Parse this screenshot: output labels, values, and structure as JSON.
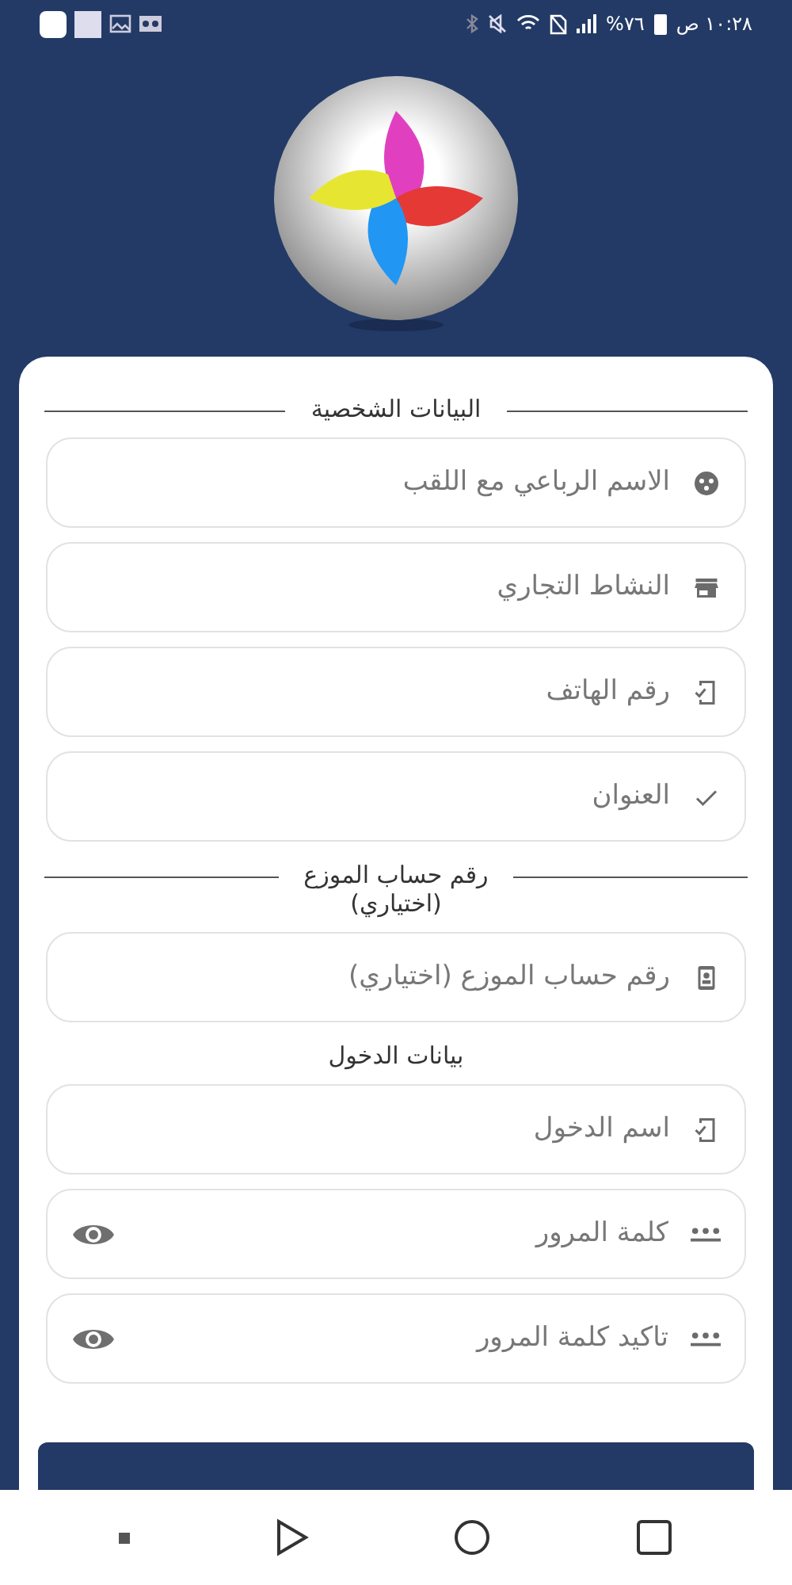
{
  "status_bar": {
    "time": "١٠:٢٨ ص",
    "battery": "%٧٦"
  },
  "sections": [
    {
      "title_lines": [
        "البيانات الشخصية"
      ],
      "divider": true,
      "fields": [
        {
          "placeholder": "الاسم الرباعي مع اللقب",
          "kind": "text"
        },
        {
          "placeholder": "النشاط التجاري",
          "kind": "text"
        },
        {
          "placeholder": "رقم الهاتف",
          "kind": "text"
        },
        {
          "placeholder": "العنوان",
          "kind": "text"
        }
      ]
    },
    {
      "title_lines": [
        "رقم حساب الموزع",
        "(اختياري)"
      ],
      "divider": true,
      "fields": [
        {
          "placeholder": "رقم حساب الموزع (اختياري)",
          "kind": "text"
        }
      ]
    },
    {
      "title_lines": [
        "بيانات الدخول"
      ],
      "divider": false,
      "fields": [
        {
          "placeholder": "اسم الدخول",
          "kind": "text"
        },
        {
          "placeholder": "كلمة المرور",
          "kind": "password"
        },
        {
          "placeholder": "تاكيد كلمة المرور",
          "kind": "password"
        }
      ]
    }
  ]
}
